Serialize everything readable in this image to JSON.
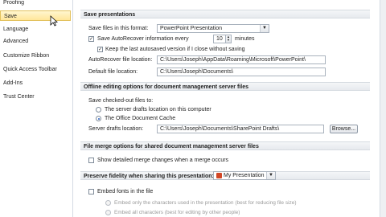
{
  "sidebar": {
    "items": [
      {
        "label": "Proofing"
      },
      {
        "label": "Save"
      },
      {
        "label": "Language"
      },
      {
        "label": "Advanced"
      },
      {
        "label": "Customize Ribbon"
      },
      {
        "label": "Quick Access Toolbar"
      },
      {
        "label": "Add-Ins"
      },
      {
        "label": "Trust Center"
      }
    ],
    "active_index": 1
  },
  "save_presentations": {
    "heading": "Save presentations",
    "format_label": "Save files in this format:",
    "format_value": "PowerPoint Presentation",
    "autorecover_label": "Save AutoRecover information every",
    "autorecover_checked": true,
    "autorecover_minutes": "10",
    "minutes_label": "minutes",
    "keep_label": "Keep the last autosaved version if I close without saving",
    "keep_checked": true,
    "autorecover_location_label": "AutoRecover file location:",
    "autorecover_location_value": "C:\\Users\\Joseph\\AppData\\Roaming\\Microsoft\\PowerPoint\\",
    "default_location_label": "Default file location:",
    "default_location_value": "C:\\Users\\Joseph\\Documents\\"
  },
  "offline": {
    "heading": "Offline editing options for document management server files",
    "save_to_label": "Save checked-out files to:",
    "option_server": "The server drafts location on this computer",
    "option_cache": "The Office Document Cache",
    "selected": "cache",
    "drafts_label": "Server drafts location:",
    "drafts_value": "C:\\Users\\Joseph\\Documents\\SharePoint Drafts\\",
    "browse_label": "Browse..."
  },
  "merge": {
    "heading": "File merge options for shared document management server files",
    "show_label": "Show detailed merge changes when a merge occurs",
    "show_checked": false
  },
  "fidelity": {
    "heading": "Preserve fidelity when sharing this presentation:",
    "presentation": "My Presentation",
    "embed_label": "Embed fonts in the file",
    "embed_checked": false,
    "embed_only_label": "Embed only the characters used in the presentation (best for reducing file size)",
    "embed_all_label": "Embed all characters (best for editing by other people)"
  },
  "colors": {
    "active_tab": "#ffe69a",
    "section_band": "#e7eaee"
  }
}
